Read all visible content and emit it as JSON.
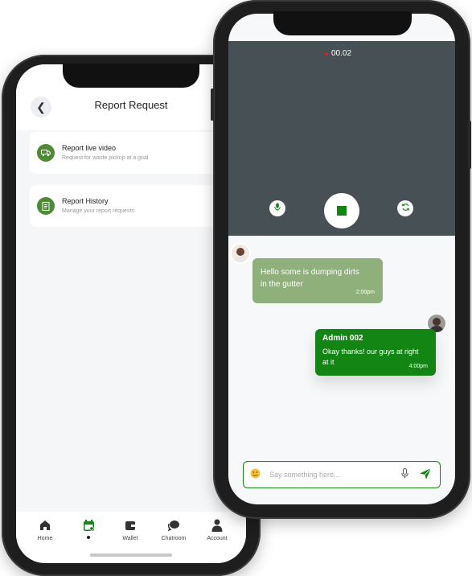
{
  "report_screen": {
    "title": "Report Request",
    "cards": [
      {
        "title": "Report live video",
        "subtitle": "Request for waste pickup at a goal",
        "icon": "truck-icon"
      },
      {
        "title": "Report History",
        "subtitle": "Manage your report requests",
        "icon": "document-icon"
      }
    ],
    "nav": [
      {
        "label": "Home",
        "icon": "home-icon"
      },
      {
        "label": "",
        "icon": "calendar-icon",
        "active": true
      },
      {
        "label": "Wallet",
        "icon": "wallet-icon"
      },
      {
        "label": "Chatroom",
        "icon": "chat-icon"
      },
      {
        "label": "Account",
        "icon": "account-icon"
      }
    ]
  },
  "chat_screen": {
    "recording_time": "00.02",
    "messages": [
      {
        "text": "Hello some is dumping dirts in the gutter",
        "time": "2:00pm"
      },
      {
        "sender": "Admin 002",
        "text": "Okay thanks! our guys at right at it",
        "time": "4:00pm"
      }
    ],
    "input_placeholder": "Say something here..."
  },
  "colors": {
    "brand_green": "#138514",
    "light_green": "#8fb07a",
    "card_icon_green": "#4f8a34",
    "video_bg": "#475055",
    "recording_red": "#e02020"
  }
}
